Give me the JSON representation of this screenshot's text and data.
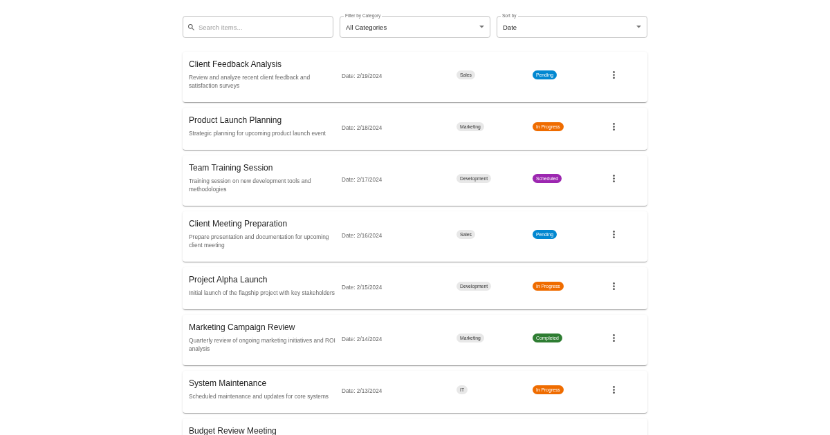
{
  "search": {
    "placeholder": "Search items..."
  },
  "filters": [
    {
      "label": "Filter by Category",
      "value": "All Categories"
    },
    {
      "label": "Sort by",
      "value": "Date"
    }
  ],
  "items": [
    {
      "title": "Client Feedback Analysis",
      "description": "Review and analyze recent client feedback and satisfaction surveys",
      "date": "Date: 2/19/2024",
      "category": "Sales",
      "status": {
        "label": "Pending",
        "color": "#0288d1"
      }
    },
    {
      "title": "Product Launch Planning",
      "description": "Strategic planning for upcoming product launch event",
      "date": "Date: 2/18/2024",
      "category": "Marketing",
      "status": {
        "label": "In Progress",
        "color": "#ef6c00"
      }
    },
    {
      "title": "Team Training Session",
      "description": "Training session on new development tools and methodologies",
      "date": "Date: 2/17/2024",
      "category": "Development",
      "status": {
        "label": "Scheduled",
        "color": "#9c27b0"
      }
    },
    {
      "title": "Client Meeting Preparation",
      "description": "Prepare presentation and documentation for upcoming client meeting",
      "date": "Date: 2/16/2024",
      "category": "Sales",
      "status": {
        "label": "Pending",
        "color": "#0288d1"
      }
    },
    {
      "title": "Project Alpha Launch",
      "description": "Initial launch of the flagship project with key stakeholders",
      "date": "Date: 2/15/2024",
      "category": "Development",
      "status": {
        "label": "In Progress",
        "color": "#ef6c00"
      }
    },
    {
      "title": "Marketing Campaign Review",
      "description": "Quarterly review of ongoing marketing initiatives and ROI analysis",
      "date": "Date: 2/14/2024",
      "category": "Marketing",
      "status": {
        "label": "Completed",
        "color": "#2e7d32"
      }
    },
    {
      "title": "System Maintenance",
      "description": "Scheduled maintenance and updates for core systems",
      "date": "Date: 2/13/2024",
      "category": "IT",
      "status": {
        "label": "In Progress",
        "color": "#ef6c00"
      }
    },
    {
      "title": "Budget Review Meeting"
    }
  ]
}
